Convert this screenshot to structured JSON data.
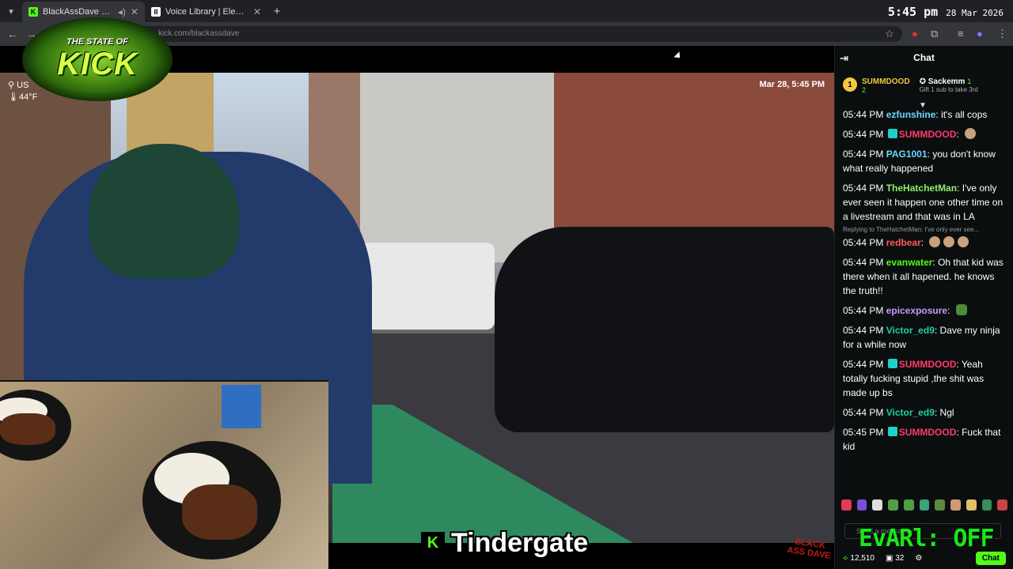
{
  "browser": {
    "tabs": [
      {
        "title": "BlackAssDave Stream - Wa",
        "favicon": "kick-logo-icon",
        "color": "#53fc18",
        "active": true
      },
      {
        "title": "Voice Library | ElevenLabs",
        "favicon": "elevenlabs-icon",
        "color": "#ffffff",
        "active": false
      }
    ],
    "url": "kick.com/blackassdave",
    "clock": {
      "time": "5:45 pm",
      "date": "28 Mar 2026"
    }
  },
  "stream": {
    "timestamp": "Mar 28, 5:45 PM",
    "location": "US",
    "temperature": "44°F",
    "logo_top": "THE STATE OF",
    "logo_main": "KICK",
    "caption": "Tindergate",
    "caption_icon": "K",
    "watermark": "BLACK ASS DAVE"
  },
  "chat": {
    "title": "Chat",
    "pinned": {
      "rank": "1",
      "user": "SUMMDOOD",
      "count": "2",
      "gifter": "Sackemm",
      "gifter_count": "1",
      "note": "Gift 1 sub to take 3rd"
    },
    "messages": [
      {
        "time": "05:44 PM",
        "user": "ezfunshine",
        "color": "#6bd7ff",
        "badge": false,
        "text": "it's all cops",
        "emotes": 0
      },
      {
        "time": "05:44 PM",
        "user": "SUMMDOOD",
        "color": "#ff3b6b",
        "badge": true,
        "text": "",
        "emotes": 1
      },
      {
        "time": "05:44 PM",
        "user": "PAG1001",
        "color": "#6bd7ff",
        "badge": false,
        "text": "you don't know what really happened",
        "emotes": 0
      },
      {
        "time": "05:44 PM",
        "user": "TheHatchetMan",
        "color": "#8ef26a",
        "badge": false,
        "text": "I've only ever seen it happen one other time on a livestream and that was in LA",
        "emotes": 0
      },
      {
        "time": "05:44 PM",
        "user": "redbear",
        "color": "#ff5a5a",
        "badge": false,
        "text": "",
        "emotes": 3,
        "reply": "Replying to TheHatchetMan: I've only ever see..."
      },
      {
        "time": "05:44 PM",
        "user": "evanwater",
        "color": "#53fc18",
        "badge": false,
        "text": "Oh that kid was there when it all hapened. he knows the truth!!",
        "emotes": 0
      },
      {
        "time": "05:44 PM",
        "user": "epicexposure",
        "color": "#c89bff",
        "badge": false,
        "text": "",
        "emotes": 1
      },
      {
        "time": "05:44 PM",
        "user": "Victor_ed9",
        "color": "#1dd1a1",
        "badge": false,
        "text": "Dave my ninja for a while now",
        "emotes": 0
      },
      {
        "time": "05:44 PM",
        "user": "SUMMDOOD",
        "color": "#ff3b6b",
        "badge": true,
        "text": "Yeah totally fucking stupid ,the shit was made up bs",
        "emotes": 0
      },
      {
        "time": "05:44 PM",
        "user": "Victor_ed9",
        "color": "#1dd1a1",
        "badge": false,
        "text": "Ngl",
        "emotes": 0
      },
      {
        "time": "05:45 PM",
        "user": "SUMMDOOD",
        "color": "#ff3b6b",
        "badge": true,
        "text": "Fuck that kid",
        "emotes": 0
      }
    ],
    "send_placeholder": "Send a message",
    "viewers": "12,510",
    "followers": "32",
    "chat_button": "Chat",
    "evarl": "EvARl: OFF"
  }
}
